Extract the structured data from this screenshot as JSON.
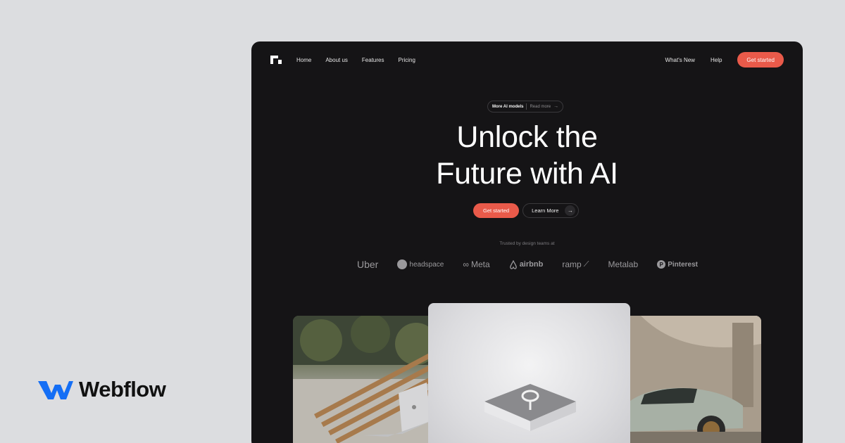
{
  "brand": {
    "name": "Webflow",
    "icon": "webflow-logo-icon",
    "color": "#146ef5"
  },
  "site": {
    "nav": {
      "logo_icon": "site-logo-icon",
      "left_links": [
        "Home",
        "About us",
        "Features",
        "Pricing"
      ],
      "right_links": [
        "What's New",
        "Help"
      ],
      "cta_label": "Get started"
    },
    "badge": {
      "label": "More AI models",
      "link": "Read more",
      "icon": "arrow-right-icon"
    },
    "hero": {
      "line1": "Unlock the",
      "line2": "Future with AI"
    },
    "cta": {
      "primary": "Get started",
      "secondary": "Learn More",
      "secondary_icon": "arrow-right-icon"
    },
    "trusted_text": "Trusted by design teams at",
    "logos": [
      "Uber",
      "headspace",
      "Meta",
      "airbnb",
      "ramp",
      "Metalab",
      "Pinterest"
    ],
    "images": [
      "laptop-on-bench-image",
      "ai-device-image",
      "sports-car-image"
    ]
  },
  "colors": {
    "accent": "#e95a4a",
    "background": "#151416",
    "page": "#dcdde0"
  }
}
